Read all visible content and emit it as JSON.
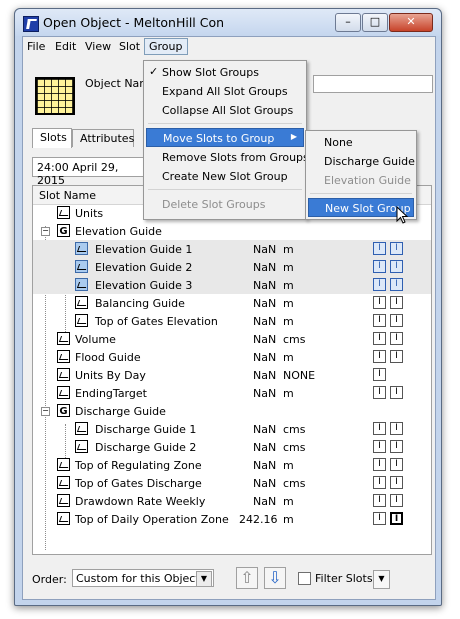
{
  "window": {
    "title": "Open Object - MeltonHill Con"
  },
  "menubar": [
    "File",
    "Edit",
    "View",
    "Slot",
    "Group"
  ],
  "object": {
    "name_label": "Object Name"
  },
  "tabs": [
    "Slots",
    "Attributes"
  ],
  "date": "24:00 April 29, 2015",
  "list": {
    "header": "Slot Name",
    "rows": [
      {
        "name": "Units",
        "value": "",
        "unit": ""
      },
      {
        "name": "Elevation Guide",
        "value": "",
        "unit": ""
      },
      {
        "name": "Elevation Guide 1",
        "value": "NaN",
        "unit": "m"
      },
      {
        "name": "Elevation Guide 2",
        "value": "NaN",
        "unit": "m"
      },
      {
        "name": "Elevation Guide 3",
        "value": "NaN",
        "unit": "m"
      },
      {
        "name": "Balancing Guide",
        "value": "NaN",
        "unit": "m"
      },
      {
        "name": "Top of Gates Elevation",
        "value": "NaN",
        "unit": "m"
      },
      {
        "name": "Volume",
        "value": "NaN",
        "unit": "cms"
      },
      {
        "name": "Flood Guide",
        "value": "NaN",
        "unit": "m"
      },
      {
        "name": "Units By Day",
        "value": "NaN",
        "unit": "NONE"
      },
      {
        "name": "EndingTarget",
        "value": "NaN",
        "unit": "m"
      },
      {
        "name": "Discharge Guide",
        "value": "",
        "unit": ""
      },
      {
        "name": "Discharge Guide 1",
        "value": "NaN",
        "unit": "cms"
      },
      {
        "name": "Discharge Guide 2",
        "value": "NaN",
        "unit": "cms"
      },
      {
        "name": "Top of Regulating Zone",
        "value": "NaN",
        "unit": "m"
      },
      {
        "name": "Top of Gates Discharge",
        "value": "NaN",
        "unit": "cms"
      },
      {
        "name": "Drawdown Rate Weekly",
        "value": "NaN",
        "unit": "m"
      },
      {
        "name": "Top of Daily Operation Zone",
        "value": "242.16",
        "unit": "m"
      }
    ]
  },
  "footer": {
    "order_label": "Order:",
    "order_value": "Custom for this Object",
    "filter_label": "Filter Slots"
  },
  "group_menu": {
    "items": [
      "Show Slot Groups",
      "Expand All Slot Groups",
      "Collapse All Slot Groups",
      "Move Slots to Group",
      "Remove Slots from Groups",
      "Create New Slot Group",
      "Delete Slot Groups"
    ]
  },
  "submenu": {
    "items": [
      "None",
      "Discharge Guide",
      "Elevation Guide",
      "New Slot Group"
    ]
  },
  "icons": {
    "up": "up-arrow-icon",
    "down": "down-arrow-icon"
  }
}
